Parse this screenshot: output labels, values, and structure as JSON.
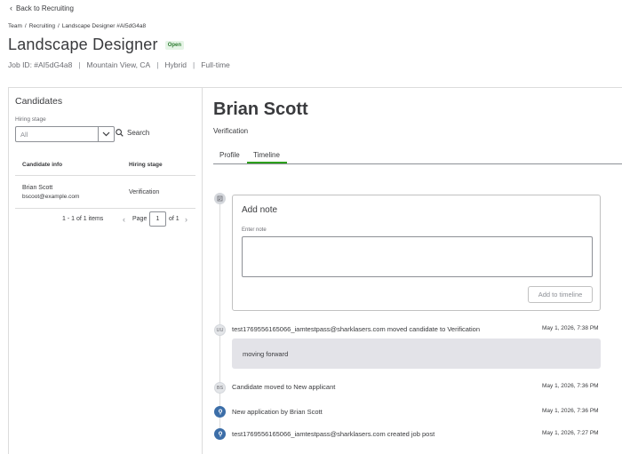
{
  "back_link": "Back to Recruiting",
  "breadcrumb": [
    "Team",
    "Recruiting",
    "Landscape Designer #AI5dG4a8"
  ],
  "job": {
    "title": "Landscape Designer",
    "status": "Open",
    "id_label": "Job ID: #AI5dG4a8",
    "location": "Mountain View, CA",
    "work_mode": "Hybrid",
    "employment": "Full-time"
  },
  "candidates_panel": {
    "title": "Candidates",
    "hiring_stage_label": "Hiring stage",
    "hiring_stage_value": "All",
    "search_label": "Search",
    "columns": [
      "Candidate info",
      "Hiring stage"
    ],
    "rows": [
      {
        "name": "Brian Scott",
        "email": "bscoot@example.com",
        "stage": "Verification"
      }
    ],
    "pager": {
      "items": "1 - 1 of 1 items",
      "page_label": "Page",
      "page": "1",
      "of": "of 1"
    }
  },
  "candidate": {
    "name": "Brian Scott",
    "stage": "Verification",
    "tabs": [
      "Profile",
      "Timeline"
    ],
    "active_tab": "Timeline"
  },
  "note": {
    "title": "Add note",
    "label": "Enter note",
    "button": "Add to timeline"
  },
  "timeline": [
    {
      "avatar": "UU",
      "text": "test1769556165066_iamtestpass@sharklasers.com moved candidate to Verification",
      "time": "May 1, 2026, 7:38 PM",
      "comment": "moving forward"
    },
    {
      "avatar": "BS",
      "text": "Candidate moved to New applicant",
      "time": "May 1, 2026, 7:36 PM"
    },
    {
      "avatar": "",
      "text": "New application by Brian Scott",
      "time": "May 1, 2026, 7:36 PM"
    },
    {
      "avatar": "",
      "text": "test1769556165066_iamtestpass@sharklasers.com created job post",
      "time": "May 1, 2026, 7:27 PM"
    }
  ],
  "colors": {
    "accent_green": "#2ca01c",
    "event_blue": "#3c6ea8",
    "comment_bg": "#e3e3e8"
  },
  "icons": {
    "back": "chevron-left-icon",
    "dropdown": "chevron-down-icon",
    "search": "search-icon",
    "note_dot": "note-icon",
    "system_event": "pin-icon"
  }
}
